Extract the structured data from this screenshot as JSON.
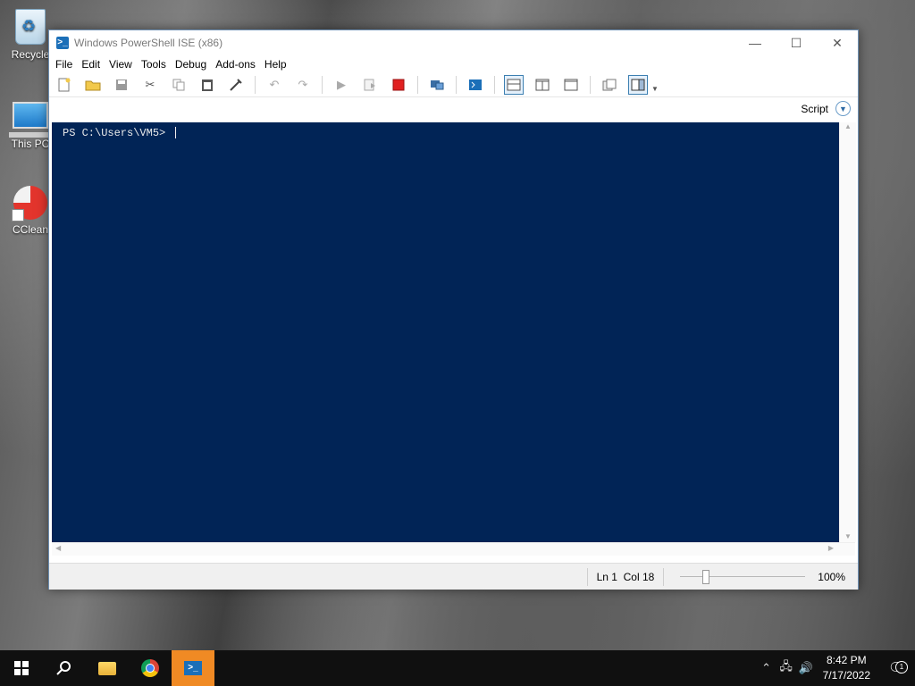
{
  "desktop": {
    "icons": [
      {
        "label": "Recycle",
        "icon": "recycle-bin-icon"
      },
      {
        "label": "This PC",
        "icon": "computer-icon"
      },
      {
        "label": "CClean",
        "icon": "ccleaner-icon"
      }
    ]
  },
  "window": {
    "title": "Windows PowerShell ISE (x86)",
    "controls": {
      "minimize": "—",
      "maximize": "☐",
      "close": "✕"
    },
    "menu": [
      "File",
      "Edit",
      "View",
      "Tools",
      "Debug",
      "Add-ons",
      "Help"
    ],
    "toolbar_icons": [
      "new-file-icon",
      "open-file-icon",
      "save-icon",
      "cut-icon",
      "copy-icon",
      "paste-icon",
      "clear-console-icon",
      "undo-icon",
      "redo-icon",
      "run-script-icon",
      "run-selection-icon",
      "stop-icon",
      "new-remote-tab-icon",
      "start-powershell-icon",
      "show-script-top-icon",
      "show-script-right-icon",
      "show-script-maximized-icon",
      "show-command-window-icon",
      "show-command-addon-icon"
    ],
    "script_toggle_label": "Script",
    "console": {
      "prompt": "PS C:\\Users\\VM5> "
    },
    "status": {
      "line": "Ln 1",
      "col": "Col 18",
      "zoom": "100%"
    },
    "colors": {
      "console_bg": "#012456",
      "console_fg": "#eaeaea"
    }
  },
  "taskbar": {
    "apps": [
      "start-icon",
      "search-icon",
      "file-explorer-icon",
      "chrome-icon",
      "powershell-ise-icon"
    ],
    "active_app": "powershell-ise-icon",
    "accent": "#f08a24",
    "time": "8:42 PM",
    "date": "7/17/2022",
    "notification_count": "1"
  }
}
